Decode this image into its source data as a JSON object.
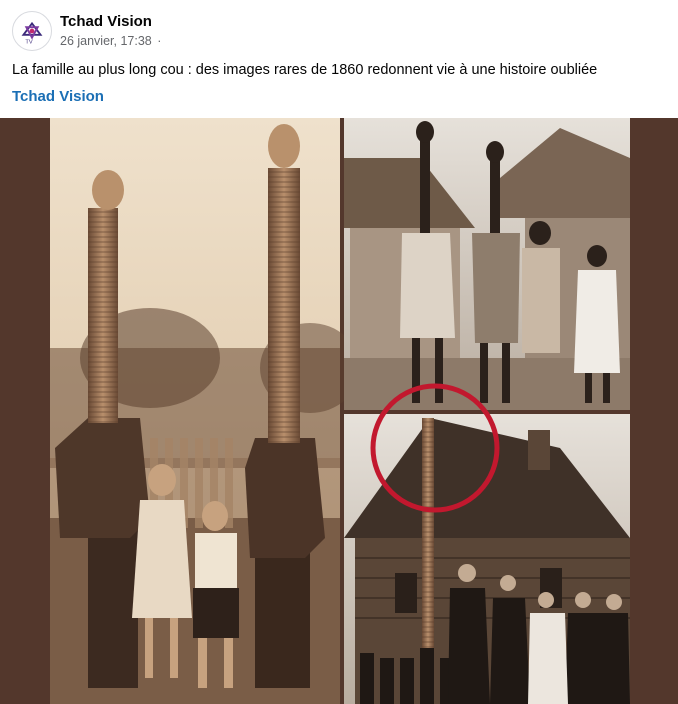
{
  "post": {
    "page_name": "Tchad Vision",
    "timestamp": "26 janvier, 17:38",
    "separator": "·",
    "caption": "La famille au plus long cou : des images rares de 1860 redonnent vie à une histoire oubliée",
    "link_name": "Tchad Vision",
    "avatar_icon": "tchad-vision-logo-icon",
    "link_color": "#1b6fb5",
    "media_border_color": "#53372c"
  }
}
